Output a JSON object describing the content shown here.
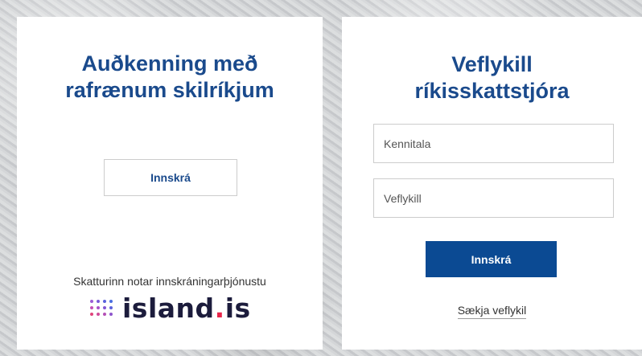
{
  "left_panel": {
    "title_line1": "Auðkenning með",
    "title_line2": "rafrænum skilríkjum",
    "login_button_label": "Innskrá",
    "provider_text": "Skatturinn notar innskráningarþjónustu",
    "logo": {
      "text_main": "island",
      "text_dot": ".",
      "text_suffix": "is",
      "dot_colors": [
        "#9b5cd6",
        "#7a5ad8",
        "#5a62dc",
        "#4a6ee0",
        "#c44fb8",
        "#a850c8",
        "#8256d4",
        "#5d62dc",
        "#e0437a",
        "#cf4a9a",
        "#b44fb6",
        "#8e55cc"
      ],
      "text_color": "#1c1c3c",
      "accent_color": "#e8254a"
    }
  },
  "right_panel": {
    "title_line1": "Veflykill",
    "title_line2": "ríkisskattstjóra",
    "kennitala_placeholder": "Kennitala",
    "veflykill_placeholder": "Veflykill",
    "login_button_label": "Innskrá",
    "fetch_link_label": "Sækja veflykil"
  },
  "colors": {
    "brand_blue": "#0b4a93",
    "title_blue": "#1a4a8c"
  }
}
